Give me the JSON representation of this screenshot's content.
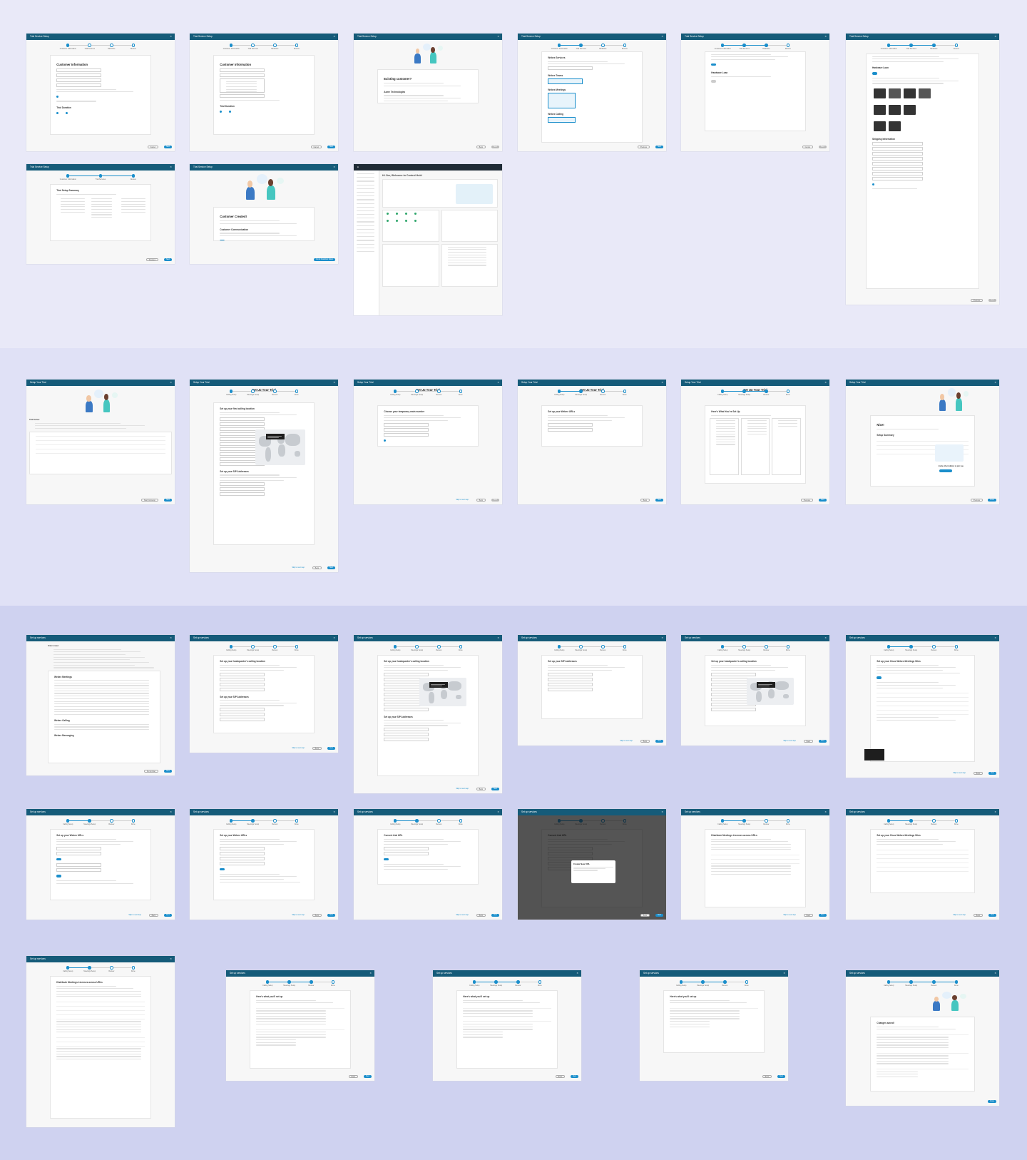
{
  "colors": {
    "header": "#155b79",
    "accent": "#1a8ecb",
    "band_top": "#e9e9f8",
    "band_middle": "#e0e1f6",
    "band_bottom": "#cfd2f0"
  },
  "icons": {
    "close": "close-icon",
    "webex": "webex-logo-icon"
  },
  "titles": {
    "trial_setup": "Trial Service Setup",
    "setup_trial": "Setup Your Trial",
    "setup_services": "Set up services"
  },
  "steps": {
    "trial_a": [
      "Customer Information",
      "Trial Services",
      "Hardware",
      "Review"
    ],
    "trial_b": [
      "Customer Information",
      "Trial Services",
      "Review"
    ],
    "wizard": [
      "Calling Setup",
      "Meetings Setup",
      "Review",
      "Done"
    ]
  },
  "headings": {
    "customer_info": "Customer Information",
    "trial_duration": "Trial Duration",
    "existing_customer": "Existing customer?",
    "acme": "Acme Technologies",
    "webex_services": "Webex Services",
    "hardware_loan": "Hardware Loan",
    "shipping": "Shipping Information",
    "trial_summary": "Trial Setup Summary",
    "customer_created": "Customer Created!",
    "customer_communication": "Customer Communication",
    "hub_welcome": "Hi Jim, Welcome to Control Hub!",
    "trial_review": "Trial Review",
    "setup_your_trial": "Set Up Your Trial",
    "first_calling_location": "Set up your first calling location",
    "sip_addresses": "Set up your SIP Addresses",
    "main_number": "Choose your temporary main number",
    "webex_urls": "Set up your Webex URLs",
    "heres_what": "Here's What You've Set Up",
    "nice": "Nice!",
    "setup_summary": "Setup Summary",
    "order_review": "Order review",
    "hq_calling_location": "Set up your headquarter's calling location",
    "cisco_webex_sites": "Set up your Cisco Webex Meetings Sites",
    "convert_urls": "Convert trial URL",
    "create_new_url": "Create New URL",
    "distribute_licenses": "Distribute Meetings Licenses across URLs",
    "heres_what_youll": "Here's what you'll set up",
    "changes_saved": "Changes saved!"
  },
  "labels": {
    "webex_meetings": "Webex Meetings",
    "webex_calling": "Webex Calling",
    "webex_teams": "Webex Teams",
    "webex_devices": "Webex Devices",
    "webex_messaging": "Webex Messaging",
    "invite_admins": "Invite other Admins to join you"
  },
  "buttons": {
    "next": "Next",
    "cancel": "Cancel",
    "previous": "Previous",
    "back": "Back",
    "skip": "Skip to next step",
    "done": "Done",
    "go_to_customer": "Go to Customer Setup",
    "setup_later": "Set up later",
    "start_trial_setup": "Start trial setup"
  }
}
